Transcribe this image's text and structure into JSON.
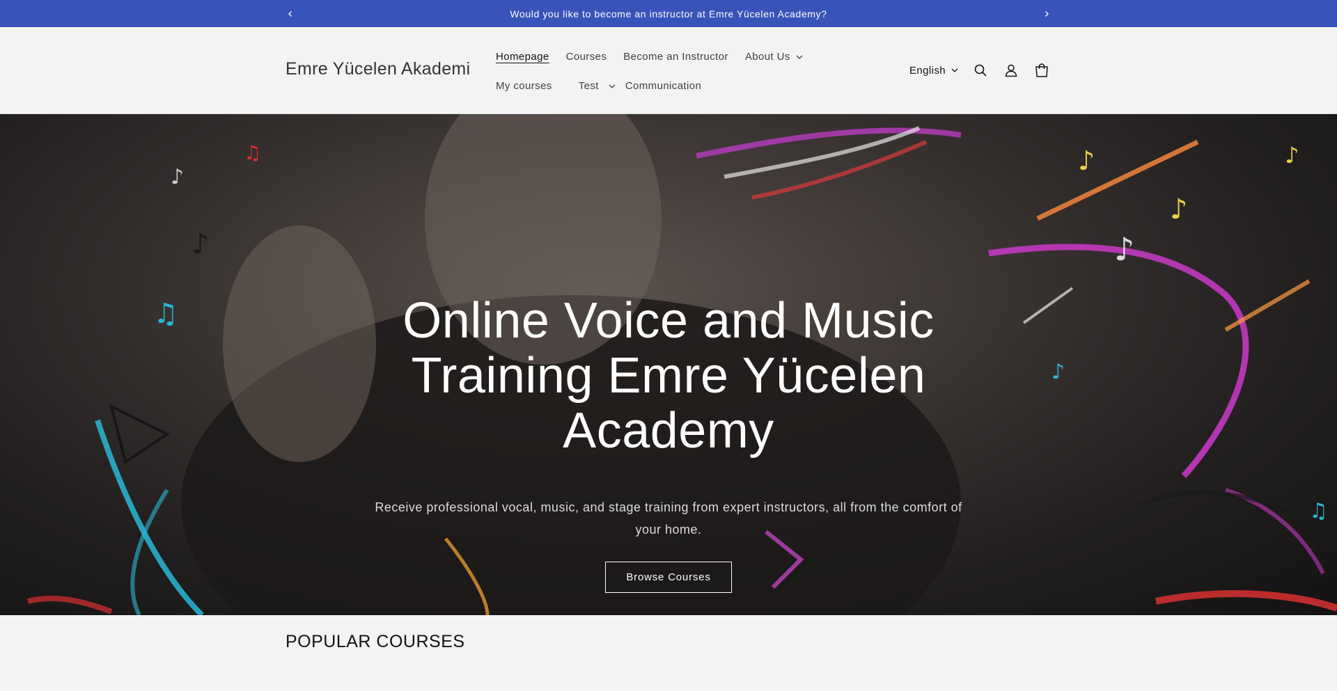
{
  "announcement": {
    "text": "Would you like to become an instructor at Emre Yücelen Academy?",
    "bg_color": "#3853b9"
  },
  "header": {
    "logo": "Emre Yücelen Akademi",
    "nav_row1": [
      {
        "label": "Homepage",
        "active": true
      },
      {
        "label": "Courses"
      },
      {
        "label": "Become an Instructor"
      },
      {
        "label": "About Us",
        "has_dropdown": true
      }
    ],
    "nav_row2": [
      {
        "label": "My courses"
      },
      {
        "label": "Test",
        "has_dropdown": true
      },
      {
        "label": "Communication"
      }
    ],
    "language": "English",
    "icons": [
      "search-icon",
      "account-icon",
      "cart-icon"
    ]
  },
  "hero": {
    "title": "Online Voice and Music Training Emre Yücelen Academy",
    "subtitle": "Receive professional vocal, music, and stage training from expert instructors, all from the comfort of your home.",
    "button": "Browse Courses"
  },
  "popular": {
    "heading": "POPULAR COURSES"
  }
}
